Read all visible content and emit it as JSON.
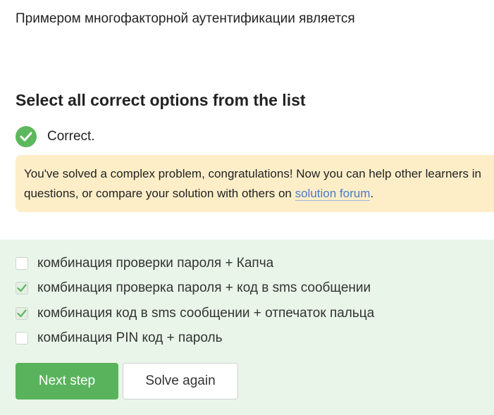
{
  "question": {
    "text": "Примером многофакторной аутентификации является"
  },
  "instruction": "Select all correct options from the list",
  "status": {
    "icon": "checkmark-circle-icon",
    "text": "Correct.",
    "color": "#5cb85c"
  },
  "notice": {
    "line1": "You've solved a complex problem, congratulations! Now you can help other learners in",
    "line2_prefix": "questions, or compare your solution with others on ",
    "link_text": "solution forum",
    "line2_suffix": ".",
    "background": "#fdeec8"
  },
  "options": [
    {
      "label": "комбинация проверки пароля + Капча",
      "checked": false
    },
    {
      "label": "комбинация проверка пароля + код в sms сообщении",
      "checked": true
    },
    {
      "label": "комбинация код в sms сообщении + отпечаток пальца",
      "checked": true
    },
    {
      "label": "комбинация PIN код + пароль",
      "checked": false
    }
  ],
  "buttons": {
    "next_step": "Next step",
    "solve_again": "Solve again"
  },
  "colors": {
    "accent_green": "#59b35c",
    "answer_panel_bg": "#e9f5e9",
    "link": "#4a79c6"
  }
}
